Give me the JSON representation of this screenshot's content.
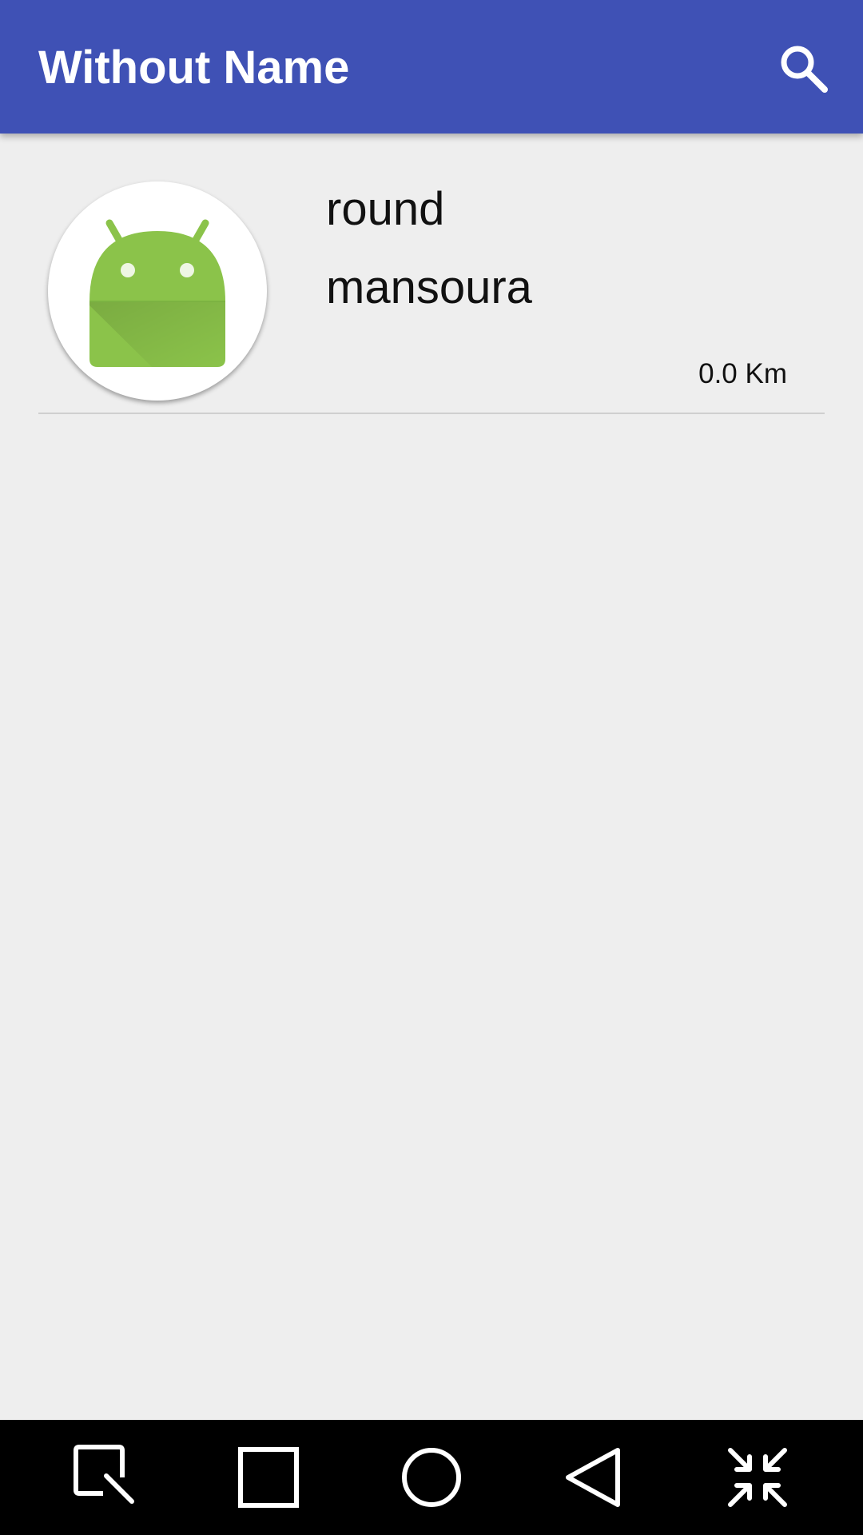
{
  "app_bar": {
    "title": "Without Name",
    "background": "#3f51b5",
    "action_icon": "search-icon"
  },
  "list": {
    "items": [
      {
        "name": "round",
        "city": "mansoura",
        "distance": "0.0 Km",
        "avatar_icon": "android-robot-icon"
      }
    ]
  },
  "nav_bar": {
    "buttons": [
      {
        "icon": "screenshot-edit-icon"
      },
      {
        "icon": "recents-square-icon"
      },
      {
        "icon": "home-circle-icon"
      },
      {
        "icon": "back-triangle-icon"
      },
      {
        "icon": "collapse-arrows-icon"
      }
    ]
  },
  "colors": {
    "primary": "#3f51b5",
    "background": "#eeeeee",
    "android_green": "#8bc34a"
  }
}
